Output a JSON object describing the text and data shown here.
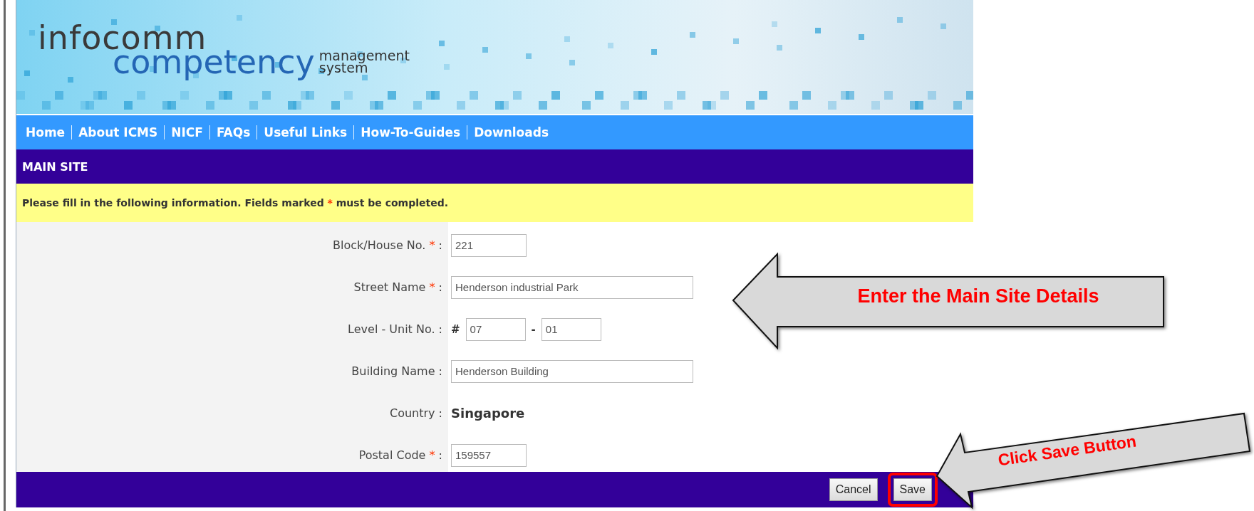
{
  "header": {
    "logo": {
      "line_1": "infocomm",
      "line_2": "competency",
      "line_3": "management",
      "line_4": "system"
    }
  },
  "nav": {
    "links": [
      "Home",
      "About ICMS",
      "NICF",
      "FAQs",
      "Useful Links",
      "How-To-Guides",
      "Downloads"
    ]
  },
  "section_title": "MAIN SITE",
  "notice": {
    "before": "Please fill in the following information. Fields marked",
    "mark": "*",
    "after": "must be completed."
  },
  "form": {
    "fields": [
      {
        "kind": "short_text",
        "label": "Block/House No.",
        "required_mark": "*",
        "colon": ":",
        "value": "221"
      },
      {
        "kind": "long_text",
        "label": "Street Name",
        "required_mark": "*",
        "colon": ":",
        "value": "Henderson industrial Park"
      },
      {
        "kind": "level_unit",
        "label": "Level - Unit No.",
        "colon": ":",
        "prefix": "#",
        "separator": "-",
        "values": [
          "07",
          "01"
        ]
      },
      {
        "kind": "long_text",
        "label": "Building Name",
        "colon": ":",
        "value": "Henderson Building"
      },
      {
        "kind": "static",
        "label": "Country",
        "colon": ":",
        "value": "Singapore"
      },
      {
        "kind": "short_text",
        "label": "Postal Code",
        "required_mark": "*",
        "colon": ":",
        "value": "159557"
      }
    ]
  },
  "buttons": [
    {
      "label": "Cancel",
      "highlighted": false
    },
    {
      "label": "Save",
      "highlighted": true
    }
  ],
  "annotations": [
    {
      "kind": "left_arrow",
      "text": "Enter the Main Site Details"
    },
    {
      "kind": "tilted_arrow",
      "text": "Click Save Button"
    }
  ]
}
